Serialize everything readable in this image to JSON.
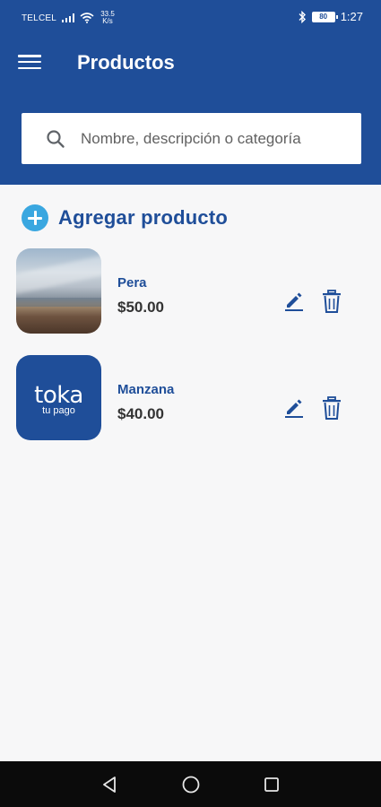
{
  "status_bar": {
    "carrier": "TELCEL",
    "speed_value": "33.5",
    "speed_unit": "K/s",
    "battery": "80",
    "time": "1:27"
  },
  "app_bar": {
    "title": "Productos",
    "menu_icon": "hamburger-menu-icon"
  },
  "search": {
    "placeholder": "Nombre, descripción o categoría",
    "value": "",
    "icon": "search-icon"
  },
  "add_product": {
    "label": "Agregar producto",
    "icon": "plus-circle-icon"
  },
  "products": [
    {
      "name": "Pera",
      "price": "$50.00",
      "image": "landscape-photo",
      "edit_icon": "pencil-icon",
      "delete_icon": "trash-icon"
    },
    {
      "name": "Manzana",
      "price": "$40.00",
      "image": "brand-logo",
      "logo_main": "toka",
      "logo_sub": "tu pago",
      "edit_icon": "pencil-icon",
      "delete_icon": "trash-icon"
    }
  ],
  "nav_bar": {
    "back_icon": "triangle-back-icon",
    "home_icon": "circle-home-icon",
    "recents_icon": "square-recents-icon"
  },
  "colors": {
    "primary": "#1f4e99",
    "accent": "#3aa7e0",
    "background": "#f7f7f8",
    "price_text": "#333333",
    "nav_bar": "#0b0b0b"
  }
}
